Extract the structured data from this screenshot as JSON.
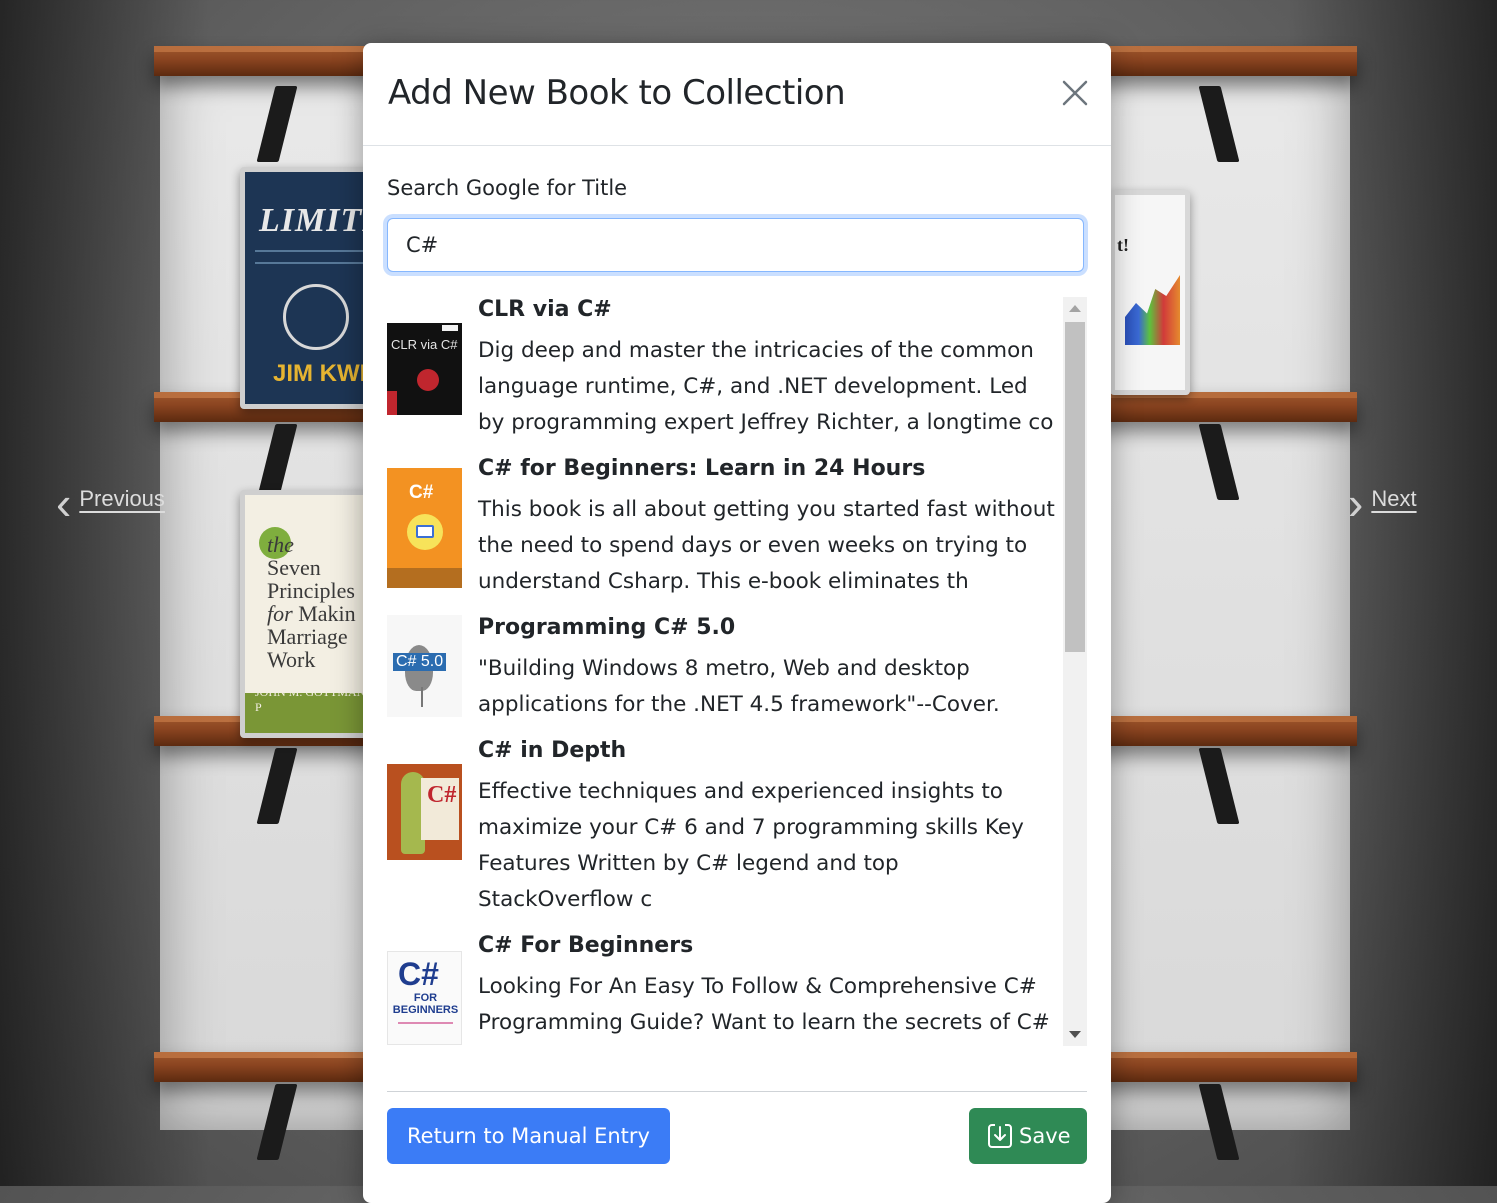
{
  "background": {
    "nav": {
      "previous_label": "Previous",
      "next_label": "Next"
    },
    "shelf_books": [
      {
        "title": "LIMITLESS",
        "author": "JIM KWIK"
      },
      {
        "title": "the Seven Principles for Making Marriage Work",
        "author": "JOHN M. GOTTMAN, PH.D."
      }
    ]
  },
  "modal": {
    "title": "Add New Book to Collection",
    "search_label": "Search Google for Title",
    "search_value": "C#",
    "results": [
      {
        "title": "CLR via C#",
        "description": "Dig deep and master the intricacies of the common language runtime, C#, and .NET development. Led by programming expert Jeffrey Richter, a longtime co",
        "cover_text": "CLR via C#"
      },
      {
        "title": "C# for Beginners: Learn in 24 Hours",
        "description": "This book is all about getting you started fast without the need to spend days or even weeks on trying to understand Csharp. This e-book eliminates th",
        "cover_text": "C#"
      },
      {
        "title": "Programming C# 5.0",
        "description": "\"Building Windows 8 metro, Web and desktop applications for the .NET 4.5 framework\"--Cover.",
        "cover_text": "C# 5.0"
      },
      {
        "title": "C# in Depth",
        "description": "Effective techniques and experienced insights to maximize your C# 6 and 7 programming skills Key Features Written by C# legend and top StackOverflow c",
        "cover_text": "C#"
      },
      {
        "title": "C# For Beginners",
        "description": "Looking For An Easy To Follow & Comprehensive C# Programming Guide? Want to learn the secrets of C#",
        "cover_text": "C#",
        "cover_subtext": "FOR BEGINNERS"
      }
    ],
    "buttons": {
      "manual_entry_label": "Return to Manual Entry",
      "save_label": "Save"
    }
  },
  "colors": {
    "primary": "#3b7cf6",
    "success": "#2f8a55",
    "focus_ring": "#86b7fe"
  },
  "icons": {
    "close": "close-icon",
    "save": "download-icon",
    "previous": "chevron-left-icon",
    "next": "chevron-right-icon"
  }
}
